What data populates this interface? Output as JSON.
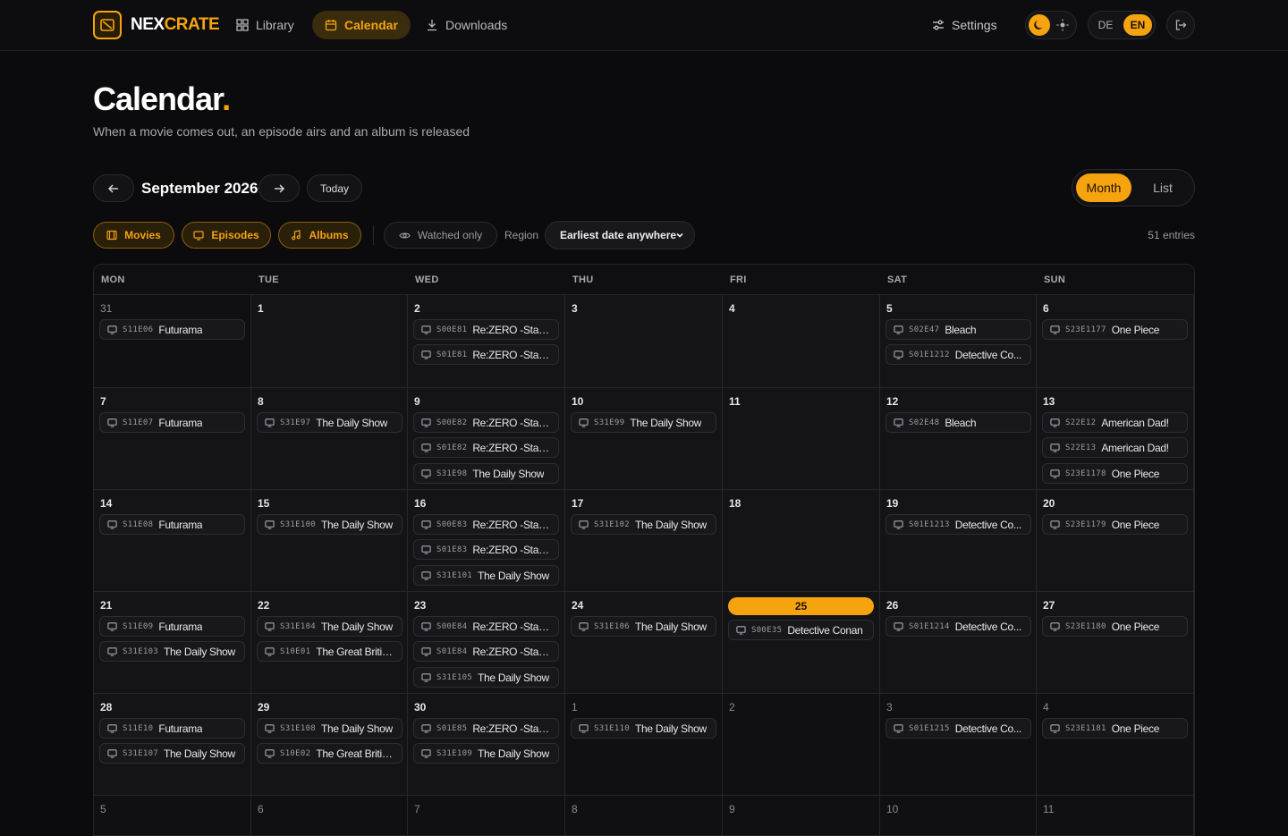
{
  "brand": {
    "part1": "NEX",
    "part2": "CRATE"
  },
  "nav": [
    {
      "label": "Library",
      "icon": "grid-icon",
      "active": false
    },
    {
      "label": "Calendar",
      "icon": "calendar-icon",
      "active": true
    },
    {
      "label": "Downloads",
      "icon": "download-icon",
      "active": false
    }
  ],
  "settings_label": "Settings",
  "languages": [
    "DE",
    "EN"
  ],
  "active_language": "EN",
  "page": {
    "title": "Calendar",
    "title_dot": ".",
    "subtitle": "When a movie comes out, an episode airs and an album is released"
  },
  "month_label": "September 2026",
  "today_label": "Today",
  "view_options": [
    "Month",
    "List"
  ],
  "active_view": "Month",
  "filters": {
    "movies": "Movies",
    "episodes": "Episodes",
    "albums": "Albums",
    "watched_only": "Watched only"
  },
  "region": {
    "label": "Region",
    "selected": "Earliest date anywhere"
  },
  "entries_label": "51 entries",
  "weekdays": [
    "MON",
    "TUE",
    "WED",
    "THU",
    "FRI",
    "SAT",
    "SUN"
  ],
  "accent_color": "#f5a30e",
  "today_date": "25",
  "weeks": [
    [
      {
        "day": "31",
        "out": true,
        "events": [
          {
            "code": "S11E06",
            "title": "Futurama"
          }
        ]
      },
      {
        "day": "1",
        "events": []
      },
      {
        "day": "2",
        "events": [
          {
            "code": "S00E81",
            "title": "Re:ZERO -Starti..."
          },
          {
            "code": "S01E81",
            "title": "Re:ZERO -Starti..."
          }
        ]
      },
      {
        "day": "3",
        "events": []
      },
      {
        "day": "4",
        "events": []
      },
      {
        "day": "5",
        "events": [
          {
            "code": "S02E47",
            "title": "Bleach"
          },
          {
            "code": "S01E1212",
            "title": "Detective Co..."
          }
        ]
      },
      {
        "day": "6",
        "events": [
          {
            "code": "S23E1177",
            "title": "One Piece"
          }
        ]
      }
    ],
    [
      {
        "day": "7",
        "events": [
          {
            "code": "S11E07",
            "title": "Futurama"
          }
        ]
      },
      {
        "day": "8",
        "events": [
          {
            "code": "S31E97",
            "title": "The Daily Show"
          }
        ]
      },
      {
        "day": "9",
        "events": [
          {
            "code": "S00E82",
            "title": "Re:ZERO -Starti..."
          },
          {
            "code": "S01E82",
            "title": "Re:ZERO -Starti..."
          },
          {
            "code": "S31E98",
            "title": "The Daily Show"
          }
        ]
      },
      {
        "day": "10",
        "events": [
          {
            "code": "S31E99",
            "title": "The Daily Show"
          }
        ]
      },
      {
        "day": "11",
        "events": []
      },
      {
        "day": "12",
        "events": [
          {
            "code": "S02E48",
            "title": "Bleach"
          }
        ]
      },
      {
        "day": "13",
        "events": [
          {
            "code": "S22E12",
            "title": "American Dad!"
          },
          {
            "code": "S22E13",
            "title": "American Dad!"
          },
          {
            "code": "S23E1178",
            "title": "One Piece"
          }
        ]
      }
    ],
    [
      {
        "day": "14",
        "events": [
          {
            "code": "S11E08",
            "title": "Futurama"
          }
        ]
      },
      {
        "day": "15",
        "events": [
          {
            "code": "S31E100",
            "title": "The Daily Show"
          }
        ]
      },
      {
        "day": "16",
        "events": [
          {
            "code": "S00E83",
            "title": "Re:ZERO -Starti..."
          },
          {
            "code": "S01E83",
            "title": "Re:ZERO -Starti..."
          },
          {
            "code": "S31E101",
            "title": "The Daily Show"
          }
        ]
      },
      {
        "day": "17",
        "events": [
          {
            "code": "S31E102",
            "title": "The Daily Show"
          }
        ]
      },
      {
        "day": "18",
        "events": []
      },
      {
        "day": "19",
        "events": [
          {
            "code": "S01E1213",
            "title": "Detective Co..."
          }
        ]
      },
      {
        "day": "20",
        "events": [
          {
            "code": "S23E1179",
            "title": "One Piece"
          }
        ]
      }
    ],
    [
      {
        "day": "21",
        "events": [
          {
            "code": "S11E09",
            "title": "Futurama"
          },
          {
            "code": "S31E103",
            "title": "The Daily Show"
          }
        ]
      },
      {
        "day": "22",
        "events": [
          {
            "code": "S31E104",
            "title": "The Daily Show"
          },
          {
            "code": "S10E01",
            "title": "The Great Britis..."
          }
        ]
      },
      {
        "day": "23",
        "events": [
          {
            "code": "S00E84",
            "title": "Re:ZERO -Starti..."
          },
          {
            "code": "S01E84",
            "title": "Re:ZERO -Starti..."
          },
          {
            "code": "S31E105",
            "title": "The Daily Show"
          }
        ]
      },
      {
        "day": "24",
        "events": [
          {
            "code": "S31E106",
            "title": "The Daily Show"
          }
        ]
      },
      {
        "day": "25",
        "today": true,
        "events": [
          {
            "code": "S00E35",
            "title": "Detective Conan"
          }
        ]
      },
      {
        "day": "26",
        "events": [
          {
            "code": "S01E1214",
            "title": "Detective Co..."
          }
        ]
      },
      {
        "day": "27",
        "events": [
          {
            "code": "S23E1180",
            "title": "One Piece"
          }
        ]
      }
    ],
    [
      {
        "day": "28",
        "events": [
          {
            "code": "S11E10",
            "title": "Futurama"
          },
          {
            "code": "S31E107",
            "title": "The Daily Show"
          }
        ]
      },
      {
        "day": "29",
        "events": [
          {
            "code": "S31E108",
            "title": "The Daily Show"
          },
          {
            "code": "S10E02",
            "title": "The Great Britis..."
          }
        ]
      },
      {
        "day": "30",
        "events": [
          {
            "code": "S01E85",
            "title": "Re:ZERO -Starti..."
          },
          {
            "code": "S31E109",
            "title": "The Daily Show"
          }
        ]
      },
      {
        "day": "1",
        "out": true,
        "events": [
          {
            "code": "S31E110",
            "title": "The Daily Show"
          }
        ]
      },
      {
        "day": "2",
        "out": true,
        "events": []
      },
      {
        "day": "3",
        "out": true,
        "events": [
          {
            "code": "S01E1215",
            "title": "Detective Co..."
          }
        ]
      },
      {
        "day": "4",
        "out": true,
        "events": [
          {
            "code": "S23E1181",
            "title": "One Piece"
          }
        ]
      }
    ],
    [
      {
        "day": "5",
        "out": true,
        "events": []
      },
      {
        "day": "6",
        "out": true,
        "events": []
      },
      {
        "day": "7",
        "out": true,
        "events": []
      },
      {
        "day": "8",
        "out": true,
        "events": []
      },
      {
        "day": "9",
        "out": true,
        "events": []
      },
      {
        "day": "10",
        "out": true,
        "events": []
      },
      {
        "day": "11",
        "out": true,
        "events": []
      }
    ]
  ]
}
